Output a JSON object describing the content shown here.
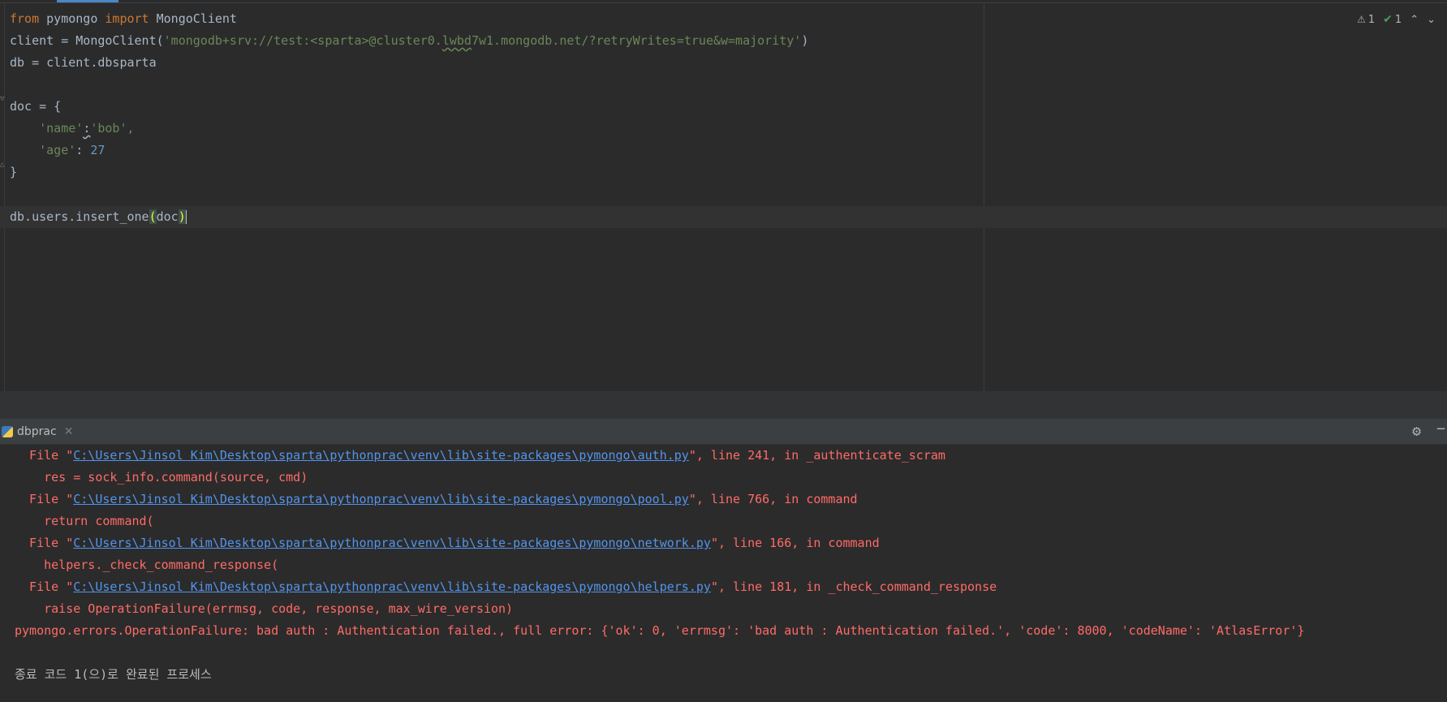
{
  "editor": {
    "lines": {
      "l1": {
        "kw_from": "from",
        "mod": " pymongo ",
        "kw_import": "import",
        "cls": " MongoClient"
      },
      "l2": {
        "pre": "client = MongoClient(",
        "str1": "'mongodb+srv://test:<sparta>@cluster0.",
        "str_wavy": "lwbd",
        "str2": "7w1.mongodb.net/?retryWrites=true&w=majority'",
        "post": ")"
      },
      "l3": {
        "text": "db = client.dbsparta"
      },
      "l5": {
        "text": "doc = {"
      },
      "l6": {
        "indent": "    ",
        "key": "'name'",
        "colon": ":",
        "val": "'bob',"
      },
      "l7": {
        "indent": "    ",
        "key": "'age'",
        "colon": ": ",
        "num": "27"
      },
      "l8": {
        "text": "}"
      },
      "l10": {
        "pre": "db.users.insert_one",
        "open": "(",
        "arg": "doc",
        "close": ")"
      }
    },
    "inspection": {
      "warnings": "1",
      "ok": "1",
      "warn_icon": "warning-icon",
      "ok_icon": "check-icon"
    }
  },
  "run_panel": {
    "tab_label": "dbprac",
    "tab_close": "✕",
    "gear": "⚙",
    "minimize": "−"
  },
  "console": {
    "f1_pre": "  File \"",
    "f1_link": "C:\\Users\\Jinsol Kim\\Desktop\\sparta\\pythonprac\\venv\\lib\\site-packages\\pymongo\\auth.py",
    "f1_post": "\", line 241, in _authenticate_scram",
    "c1": "    res = sock_info.command(source, cmd)",
    "f2_pre": "  File \"",
    "f2_link": "C:\\Users\\Jinsol Kim\\Desktop\\sparta\\pythonprac\\venv\\lib\\site-packages\\pymongo\\pool.py",
    "f2_post": "\", line 766, in command",
    "c2": "    return command(",
    "f3_pre": "  File \"",
    "f3_link": "C:\\Users\\Jinsol Kim\\Desktop\\sparta\\pythonprac\\venv\\lib\\site-packages\\pymongo\\network.py",
    "f3_post": "\", line 166, in command",
    "c3": "    helpers._check_command_response(",
    "f4_pre": "  File \"",
    "f4_link": "C:\\Users\\Jinsol Kim\\Desktop\\sparta\\pythonprac\\venv\\lib\\site-packages\\pymongo\\helpers.py",
    "f4_post": "\", line 181, in _check_command_response",
    "c4": "    raise OperationFailure(errmsg, code, response, max_wire_version)",
    "error": "pymongo.errors.OperationFailure: bad auth : Authentication failed., full error: {'ok': 0, 'errmsg': 'bad auth : Authentication failed.', 'code': 8000, 'codeName': 'AtlasError'}",
    "exit": "종료 코드 1(으)로 완료된 프로세스"
  }
}
